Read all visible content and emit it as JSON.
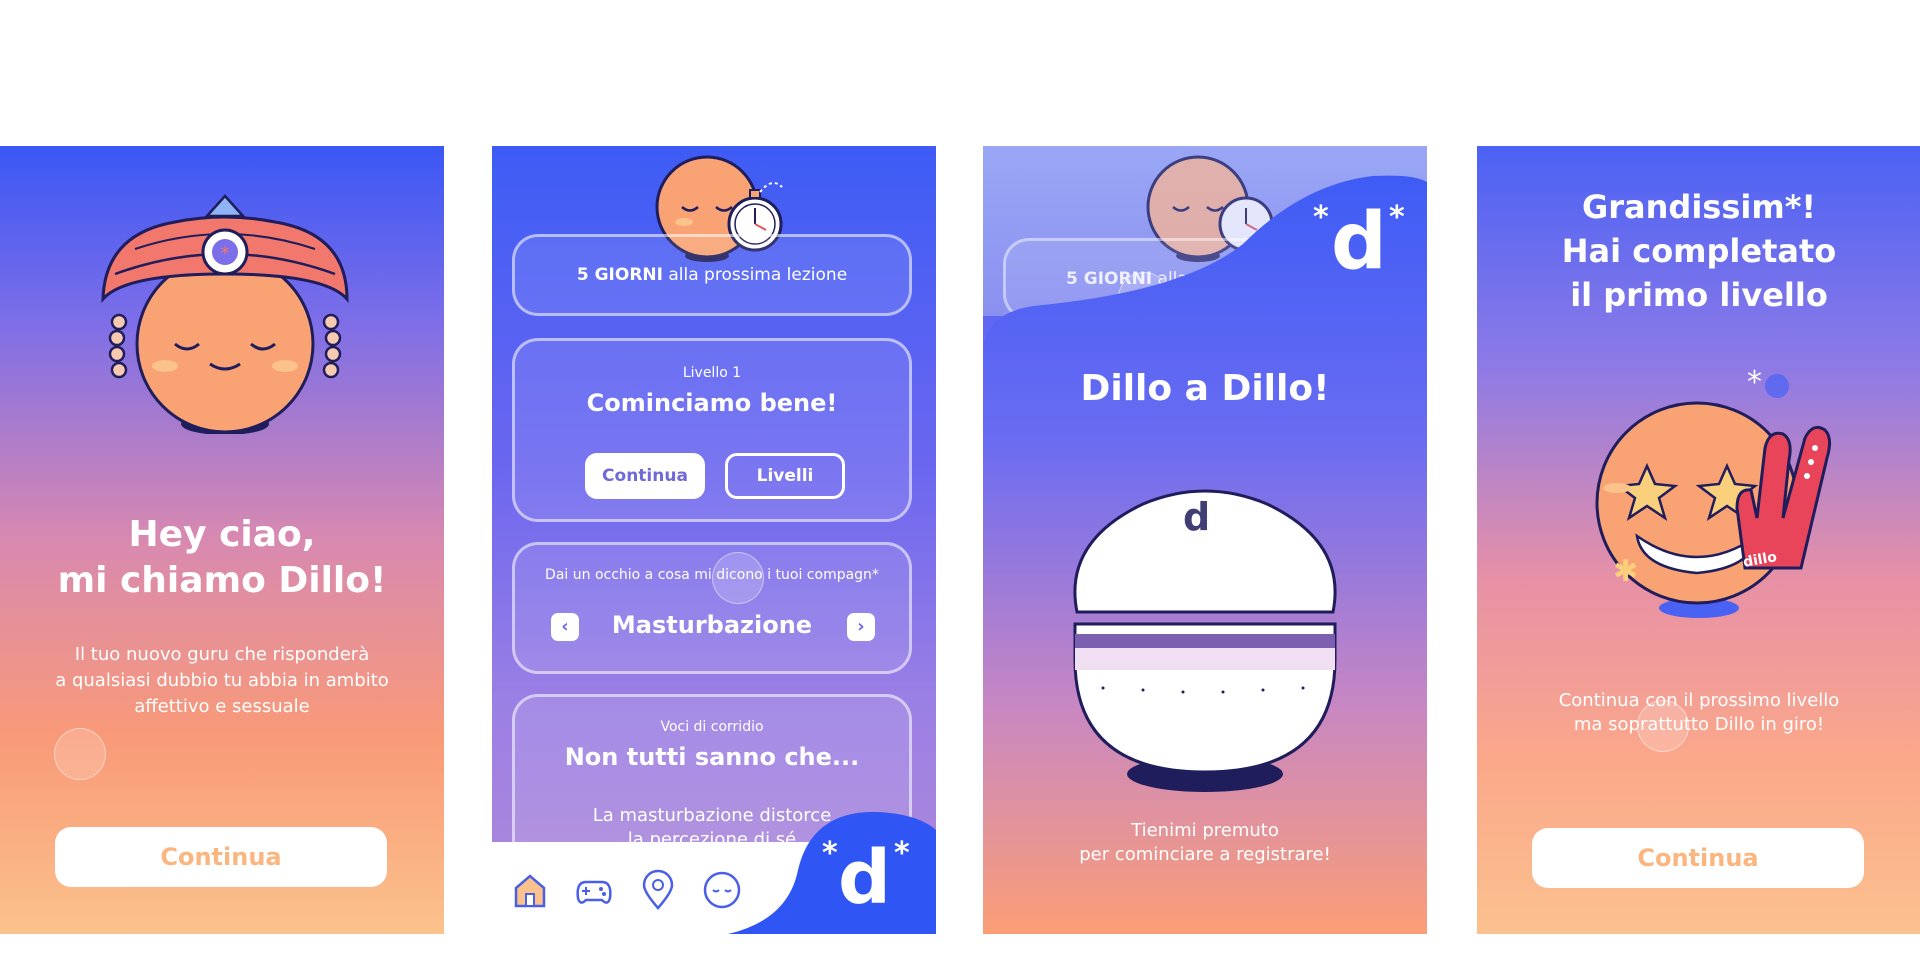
{
  "screen1": {
    "title_line1": "Hey ciao,",
    "title_line2": "mi chiamo Dillo!",
    "desc_line1": "Il tuo nuovo guru che risponderà",
    "desc_line2": "a qualsiasi dubbio tu abbia in ambito",
    "desc_line3": "affettivo e sessuale",
    "continue_label": "Continua"
  },
  "screen2": {
    "countdown_strong": "5 GIORNI",
    "countdown_rest": " alla prossima lezione",
    "level_label": "Livello 1",
    "level_title": "Cominciamo bene!",
    "continue_label": "Continua",
    "levels_label": "Livelli",
    "peers_label": "Dai un occhio a cosa mi dicono i tuoi compagn*",
    "topic": "Masturbazione",
    "rumors_label": "Voci di corridio",
    "rumors_title": "Non tutti sanno che...",
    "rumors_text1": "La masturbazione distorce",
    "rumors_text2": "la percezione di sé",
    "logo_letter": "d",
    "logo_star": "*"
  },
  "screen3": {
    "countdown_strong": "5 GIORNI",
    "countdown_rest": " alla prossi",
    "title": "Dillo a Dillo!",
    "hint_line1": "Tienimi premuto",
    "hint_line2": "per cominciare a registrare!",
    "logo_letter": "d",
    "logo_star": "*"
  },
  "screen4": {
    "title_line1": "Grandissim*!",
    "title_line2": "Hai completato",
    "title_line3": "il primo livello",
    "desc_line1": "Continua con il prossimo livello",
    "desc_line2": "ma soprattutto Dillo in giro!",
    "continue_label": "Continua",
    "foam_hand_text": "dillo"
  },
  "colors": {
    "orange_face": "#f9a273",
    "outline": "#1f1d5c",
    "turban": "#f2776c",
    "accent_blue": "#3d5cf5",
    "cta_text": "#fbb57e"
  }
}
